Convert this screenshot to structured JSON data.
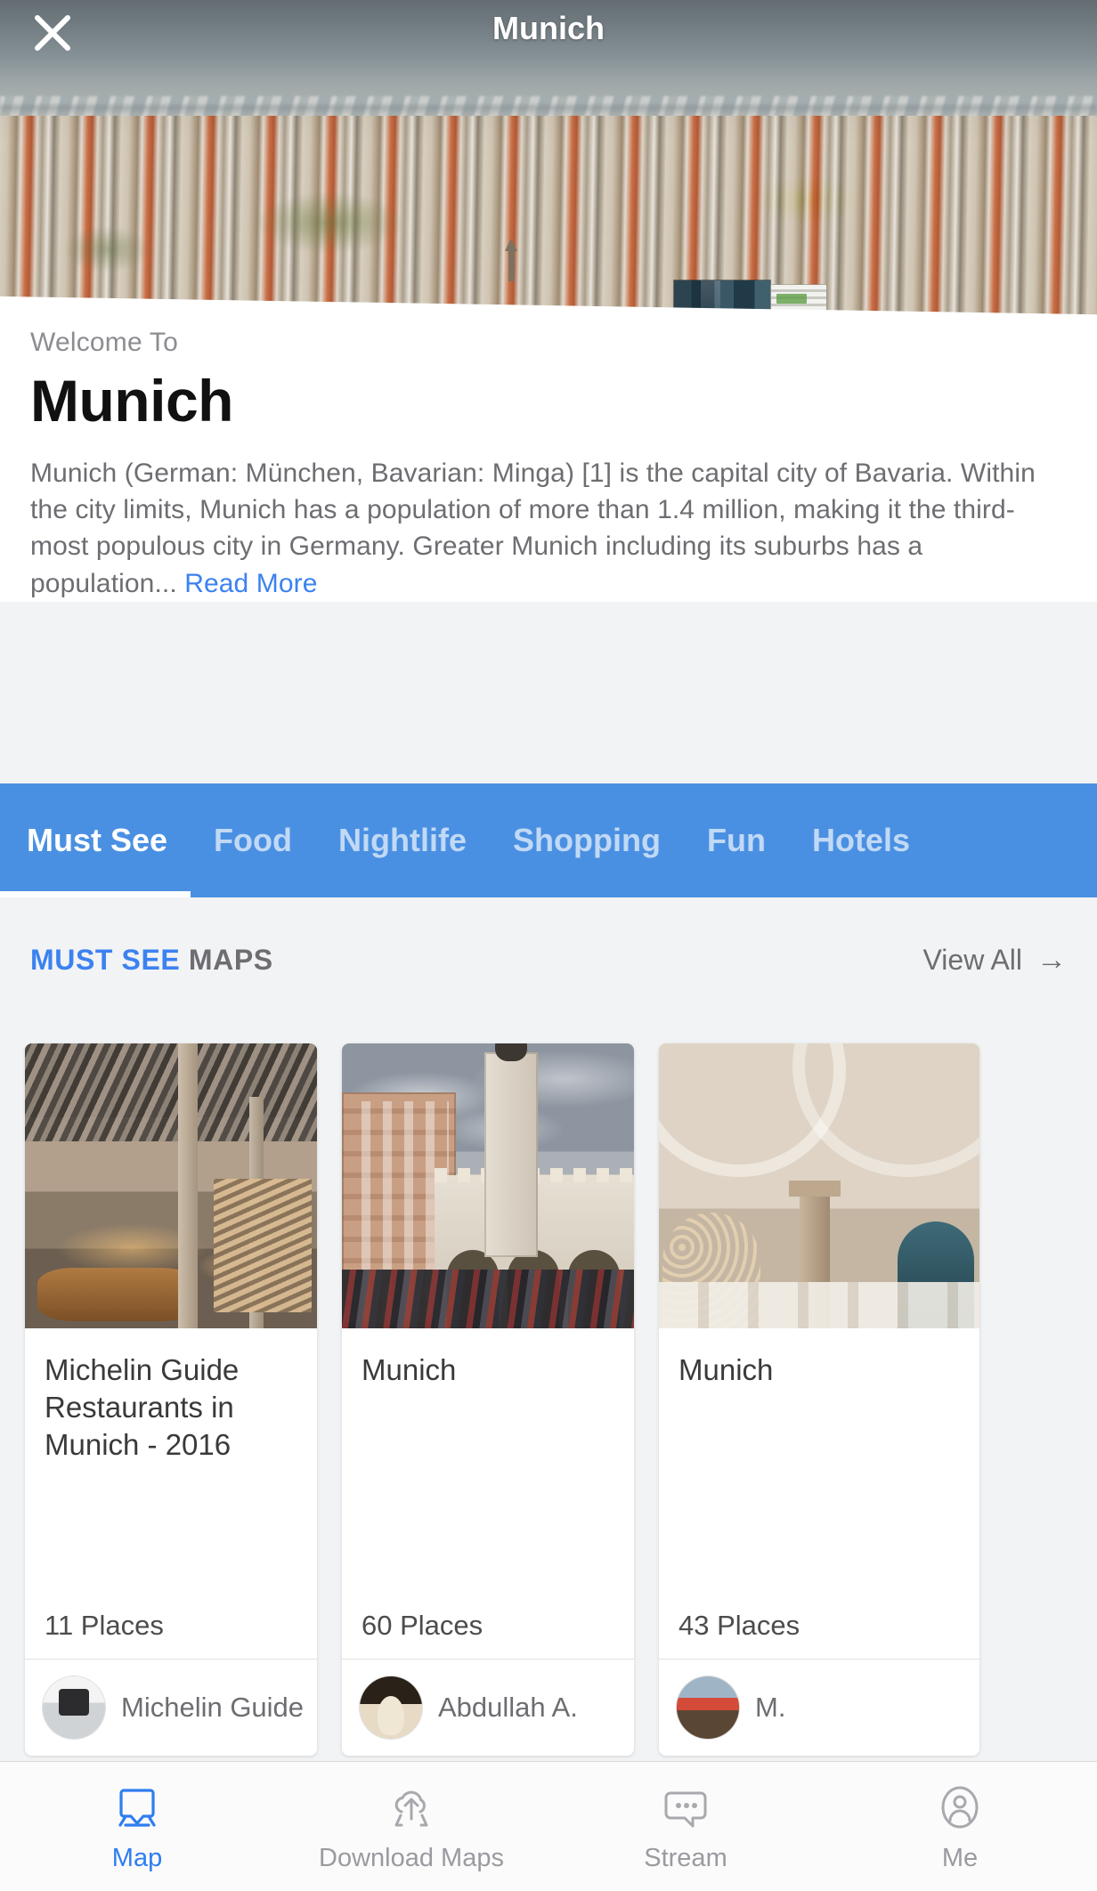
{
  "header": {
    "title": "Munich",
    "close_icon": "close-icon"
  },
  "intro": {
    "welcome": "Welcome To",
    "city": "Munich",
    "description": "Munich (German: München, Bavarian: Minga) [1] is the capital city of Bavaria. Within the city limits, Munich has a population of more than 1.4 million, making it the third-most populous city in Germany. Greater Munich including its suburbs has a population...",
    "read_more": "Read More"
  },
  "tabs": {
    "active": "Must See",
    "items": [
      {
        "label": "Must See"
      },
      {
        "label": "Food"
      },
      {
        "label": "Nightlife"
      },
      {
        "label": "Shopping"
      },
      {
        "label": "Fun"
      },
      {
        "label": "Hotels"
      }
    ]
  },
  "section": {
    "title_highlight": "MUST SEE",
    "title_rest": "MAPS",
    "view_all": "View All",
    "view_all_icon": "arrow-right-icon"
  },
  "cards": [
    {
      "title": "Michelin Guide Restaurants in Munich - 2016",
      "places": "11 Places",
      "author": "Michelin Guide",
      "image_alt": "modern market hall restaurant interior"
    },
    {
      "title": "Munich",
      "places": "60 Places",
      "author": "Abdullah A.",
      "image_alt": "Sendlinger Tor city gate with crowd"
    },
    {
      "title": "Munich",
      "places": "43 Places",
      "author": "M.",
      "image_alt": "vaulted hall interior with stone column"
    }
  ],
  "bottom_nav": {
    "active": "Map",
    "items": [
      {
        "label": "Map",
        "icon": "map-pin-icon"
      },
      {
        "label": "Download Maps",
        "icon": "cloud-upload-map-icon"
      },
      {
        "label": "Stream",
        "icon": "speech-bubble-icon"
      },
      {
        "label": "Me",
        "icon": "person-circle-icon"
      }
    ]
  },
  "colors": {
    "accent_blue": "#3b82f0",
    "tab_bar_blue": "#4a90e2",
    "page_bg": "#f2f3f5",
    "muted_text": "#6d6d72"
  }
}
